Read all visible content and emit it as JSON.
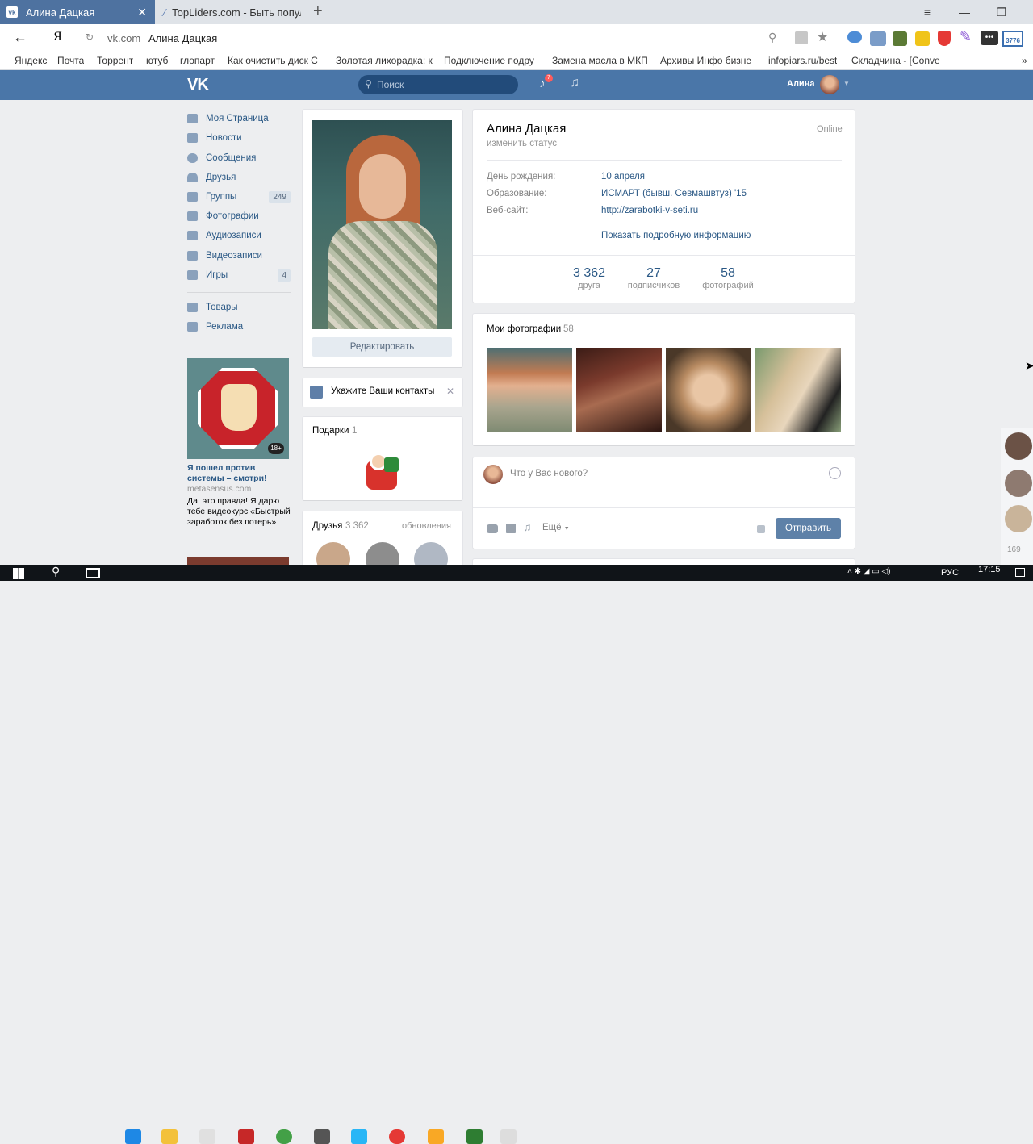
{
  "browser": {
    "tabs": [
      {
        "title": "Алина Дацкая",
        "favicon": "vk-icon"
      },
      {
        "title": "TopLiders.com - Быть попул",
        "favicon": "page-icon"
      }
    ],
    "address": {
      "domain": "vk.com",
      "page_title": "Алина Дацкая"
    },
    "yandex_logo": "Я",
    "bookmarks": [
      "Яндекс",
      "Почта",
      "Торрент",
      "ютуб",
      "глопарт",
      "Как очистить диск С",
      "Золотая лихорадка: к",
      "Подключение подру",
      "Замена масла в МКП",
      "Архивы Инфо бизне",
      "infopiars.ru/best",
      "Складчина - [Conve"
    ],
    "ext_badge": "3776"
  },
  "vk": {
    "logo": "VK",
    "search_placeholder": "Поиск",
    "notif_count": "7",
    "user_name": "Алина",
    "accent": "#4a76a8"
  },
  "nav": [
    {
      "label": "Моя Страница",
      "icon": "home-icon"
    },
    {
      "label": "Новости",
      "icon": "news-icon"
    },
    {
      "label": "Сообщения",
      "icon": "chat-icon"
    },
    {
      "label": "Друзья",
      "icon": "user-icon"
    },
    {
      "label": "Группы",
      "icon": "users-icon",
      "count": "249"
    },
    {
      "label": "Фотографии",
      "icon": "camera-icon"
    },
    {
      "label": "Аудиозаписи",
      "icon": "music-icon"
    },
    {
      "label": "Видеозаписи",
      "icon": "video-icon"
    },
    {
      "label": "Игры",
      "icon": "gamepad-icon",
      "count": "4"
    },
    {
      "label": "Товары",
      "icon": "bag-icon"
    },
    {
      "label": "Реклама",
      "icon": "megaphone-icon"
    }
  ],
  "ad": {
    "badge": "18+",
    "title": "Я пошел против системы – смотри!",
    "domain": "metasensus.com",
    "text": "Да, это правда! Я дарю тебе видеокурс «Быстрый заработок без потерь»"
  },
  "profile": {
    "edit_button": "Редактировать",
    "contacts_hint": "Укажите Ваши контакты",
    "gifts_title": "Подарки",
    "gifts_count": "1",
    "friends_title": "Друзья",
    "friends_count": "3 362",
    "friends_updates": "обновления",
    "name": "Алина Дацкая",
    "status_link": "изменить статус",
    "online": "Online",
    "info": [
      {
        "label": "День рождения:",
        "value": "10 апреля"
      },
      {
        "label": "Образование:",
        "value": "ИСМАРТ (бывш. Севмашвтуз) '15"
      },
      {
        "label": "Веб-сайт:",
        "value": "http://zarabotki-v-seti.ru"
      }
    ],
    "more_info": "Показать подробную информацию",
    "counters": [
      {
        "num": "3 362",
        "label": "друга"
      },
      {
        "num": "27",
        "label": "подписчиков"
      },
      {
        "num": "58",
        "label": "фотографий"
      }
    ],
    "photos_title": "Мои фотографии",
    "photos_count": "58",
    "post_placeholder": "Что у Вас нового?",
    "post_more": "Ещё",
    "post_submit": "Отправить"
  },
  "chat_side": {
    "count": "169"
  },
  "taskbar": {
    "lang": "РУС",
    "time": "17:15"
  }
}
